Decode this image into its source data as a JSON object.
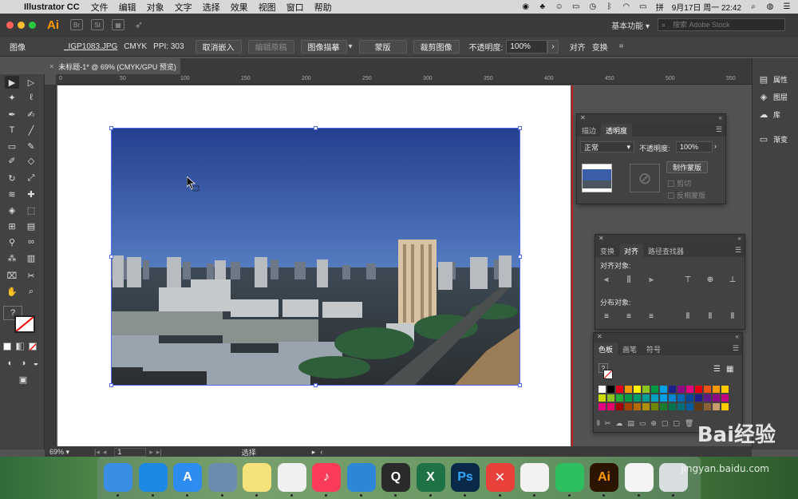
{
  "menubar": {
    "app_name": "Illustrator CC",
    "items": [
      "文件",
      "编辑",
      "对象",
      "文字",
      "选择",
      "效果",
      "视图",
      "窗口",
      "帮助"
    ],
    "clock": "9月17日 周一  22:42",
    "battery_icon": "battery-icon",
    "wifi_icon": "wifi-icon"
  },
  "apptop": {
    "logo": "Ai",
    "bridge": "Br",
    "stock": "St",
    "workspace": "基本功能",
    "search_placeholder": "搜索 Adobe Stock"
  },
  "control": {
    "object_type": "图像",
    "filename": "_IGP1083.JPG",
    "color_mode": "CMYK",
    "ppi": "PPI: 303",
    "unembed": "取消嵌入",
    "edit_original": "编辑原稿",
    "image_trace": "图像描摹",
    "mask": "蒙版",
    "crop": "裁剪图像",
    "opacity_label": "不透明度:",
    "opacity_value": "100%",
    "align": "对齐",
    "transform": "变换"
  },
  "doc": {
    "tab_title": "未标题-1* @ 69% (CMYK/GPU 预览)",
    "ruler_ticks": [
      "0",
      "50",
      "100",
      "150",
      "200",
      "250",
      "300",
      "350",
      "400",
      "450",
      "500",
      "550"
    ]
  },
  "status": {
    "zoom": "69%",
    "page": "1",
    "tool": "选择"
  },
  "rightcol": {
    "items": [
      {
        "label": "属性",
        "icon": "properties-icon"
      },
      {
        "label": "图层",
        "icon": "layers-icon"
      },
      {
        "label": "库",
        "icon": "libraries-icon"
      },
      {
        "label": "渐变",
        "icon": "gradient-icon"
      }
    ]
  },
  "transparency_panel": {
    "tabs": [
      "描边",
      "透明度"
    ],
    "blend_mode": "正常",
    "opacity_label": "不透明度:",
    "opacity_value": "100%",
    "make_mask": "制作蒙版",
    "clip": "剪切",
    "invert_mask": "反相蒙版"
  },
  "align_panel": {
    "tabs": [
      "变换",
      "对齐",
      "路径查找器"
    ],
    "align_objects": "对齐对象:",
    "distribute_objects": "分布对象:"
  },
  "swatches_panel": {
    "tabs": [
      "色板",
      "画笔",
      "符号"
    ],
    "colors": [
      "#ffffff",
      "#000000",
      "#e6001f",
      "#f39800",
      "#fff100",
      "#8fc31f",
      "#009944",
      "#00a0e9",
      "#1d2088",
      "#920783",
      "#e4007f",
      "#e60012",
      "#ea5514",
      "#f39800",
      "#fcc800",
      "#cfdb00",
      "#8fc31f",
      "#22ac38",
      "#009944",
      "#009b6b",
      "#009e96",
      "#00a0c1",
      "#00a0e9",
      "#0086d1",
      "#0068b7",
      "#00479d",
      "#1d2088",
      "#601986",
      "#920783",
      "#be0081",
      "#e5007f",
      "#e5006a",
      "#a40000",
      "#a84200",
      "#b26b00",
      "#ae8e00",
      "#6b8600",
      "#1a7a2e",
      "#00734d",
      "#006f7a",
      "#005e9e",
      "#603813",
      "#8c6239",
      "#c69c6d",
      "#ffcc00"
    ]
  },
  "dock": {
    "apps": [
      {
        "name": "Finder",
        "icon": "finder-icon",
        "color": "#3a8ee6",
        "glyph": ""
      },
      {
        "name": "Safari",
        "icon": "safari-icon",
        "color": "#1e88e5",
        "glyph": ""
      },
      {
        "name": "App Store",
        "icon": "appstore-icon",
        "color": "#2d8cf0",
        "glyph": "A"
      },
      {
        "name": "Mail",
        "icon": "mail-icon",
        "color": "#6a8caf",
        "glyph": ""
      },
      {
        "name": "Notes",
        "icon": "notes-icon",
        "color": "#f6e27a",
        "glyph": ""
      },
      {
        "name": "Photos",
        "icon": "photos-icon",
        "color": "#f0f0f0",
        "glyph": ""
      },
      {
        "name": "Music",
        "icon": "music-icon",
        "color": "#fa3c5a",
        "glyph": "♪"
      },
      {
        "name": "Keynote",
        "icon": "keynote-icon",
        "color": "#2c87d6",
        "glyph": ""
      },
      {
        "name": "QuickTime",
        "icon": "quicktime-icon",
        "color": "#2a2a2a",
        "glyph": "Q"
      },
      {
        "name": "Excel",
        "icon": "excel-icon",
        "color": "#1f7244",
        "glyph": "X"
      },
      {
        "name": "Photoshop",
        "icon": "photoshop-icon",
        "color": "#0b2a4a",
        "glyph": "Ps"
      },
      {
        "name": "XMind",
        "icon": "xmind-icon",
        "color": "#e8403a",
        "glyph": "✕"
      },
      {
        "name": "QQ",
        "icon": "qq-icon",
        "color": "#f2f2f2",
        "glyph": ""
      },
      {
        "name": "Evernote",
        "icon": "evernote-icon",
        "color": "#2dbe60",
        "glyph": ""
      },
      {
        "name": "Illustrator",
        "icon": "illustrator-icon",
        "color": "#2b1500",
        "glyph": "Ai"
      },
      {
        "name": "Document",
        "icon": "document-icon",
        "color": "#f4f4f4",
        "glyph": ""
      },
      {
        "name": "Trash",
        "icon": "trash-icon",
        "color": "#d8dde0",
        "glyph": ""
      }
    ]
  },
  "watermark": {
    "brand": "Bai经验",
    "url": "jingyan.baidu.com"
  }
}
